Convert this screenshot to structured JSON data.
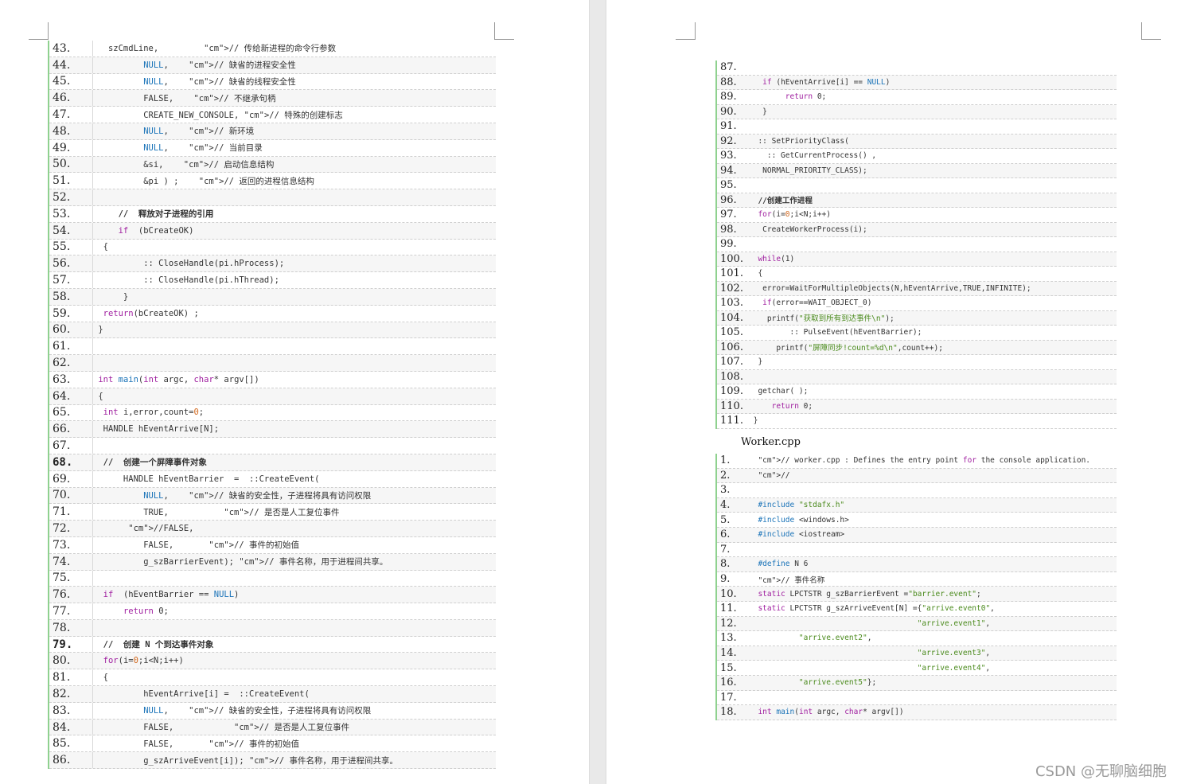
{
  "left_page": {
    "lines": [
      {
        "n": "43.",
        "code": "   szCmdLine,         // 传给新进程的命令行参数",
        "cls": "cmline"
      },
      {
        "n": "44.",
        "code": "          NULL,    // 缺省的进程安全性"
      },
      {
        "n": "45.",
        "code": "          NULL,    // 缺省的线程安全性"
      },
      {
        "n": "46.",
        "code": "          FALSE,    // 不继承句柄"
      },
      {
        "n": "47.",
        "code": "          CREATE_NEW_CONSOLE, // 特殊的创建标志"
      },
      {
        "n": "48.",
        "code": "          NULL,    // 新环境"
      },
      {
        "n": "49.",
        "code": "          NULL,    // 当前目录"
      },
      {
        "n": "50.",
        "code": "          &si,    // 启动信息结构"
      },
      {
        "n": "51.",
        "code": "          &pi ) ;    // 返回的进程信息结构"
      },
      {
        "n": "52.",
        "code": ""
      },
      {
        "n": "53.",
        "code": "     //  释放对子进程的引用"
      },
      {
        "n": "54.",
        "code": "     if  (bCreateOK)"
      },
      {
        "n": "55.",
        "code": "  {"
      },
      {
        "n": "56.",
        "code": "          :: CloseHandle(pi.hProcess);"
      },
      {
        "n": "57.",
        "code": "          :: CloseHandle(pi.hThread);"
      },
      {
        "n": "58.",
        "code": "      }"
      },
      {
        "n": "59.",
        "code": "  return(bCreateOK) ;"
      },
      {
        "n": "60.",
        "code": " }"
      },
      {
        "n": "61.",
        "code": ""
      },
      {
        "n": "62.",
        "code": ""
      },
      {
        "n": "63.",
        "code": " int main(int argc, char* argv[])"
      },
      {
        "n": "64.",
        "code": " {"
      },
      {
        "n": "65.",
        "code": "  int i,error,count=0;"
      },
      {
        "n": "66.",
        "code": "  HANDLE hEventArrive[N];"
      },
      {
        "n": "67.",
        "code": ""
      },
      {
        "n": "68.",
        "code": "  //  创建一个屏障事件对象"
      },
      {
        "n": "69.",
        "code": "      HANDLE hEventBarrier  =  ::CreateEvent("
      },
      {
        "n": "70.",
        "code": "          NULL,    // 缺省的安全性，子进程将具有访问权限"
      },
      {
        "n": "71.",
        "code": "          TRUE,           // 是否是人工复位事件"
      },
      {
        "n": "72.",
        "code": "       //FALSE,"
      },
      {
        "n": "73.",
        "code": "          FALSE,       // 事件的初始值"
      },
      {
        "n": "74.",
        "code": "          g_szBarrierEvent); // 事件名称，用于进程间共享。"
      },
      {
        "n": "75.",
        "code": ""
      },
      {
        "n": "76.",
        "code": "  if  (hEventBarrier == NULL)"
      },
      {
        "n": "77.",
        "code": "      return 0;"
      },
      {
        "n": "78.",
        "code": ""
      },
      {
        "n": "79.",
        "code": "  //  创建 N 个到达事件对象"
      },
      {
        "n": "80.",
        "code": "  for(i=0;i<N;i++)"
      },
      {
        "n": "81.",
        "code": "  {"
      },
      {
        "n": "82.",
        "code": "          hEventArrive[i] =  ::CreateEvent("
      },
      {
        "n": "83.",
        "code": "          NULL,    // 缺省的安全性，子进程将具有访问权限"
      },
      {
        "n": "84.",
        "code": "          FALSE,            // 是否是人工复位事件"
      },
      {
        "n": "85.",
        "code": "          FALSE,       // 事件的初始值"
      },
      {
        "n": "86.",
        "code": "          g_szArriveEvent[i]); // 事件名称，用于进程间共享。"
      }
    ]
  },
  "right_page": {
    "lines": [
      {
        "n": "87.",
        "code": ""
      },
      {
        "n": "88.",
        "code": "   if (hEventArrive[i] == NULL)"
      },
      {
        "n": "89.",
        "code": "        return 0;"
      },
      {
        "n": "90.",
        "code": "   }"
      },
      {
        "n": "91.",
        "code": ""
      },
      {
        "n": "92.",
        "code": "  :: SetPriorityClass("
      },
      {
        "n": "93.",
        "code": "    :: GetCurrentProcess() ,"
      },
      {
        "n": "94.",
        "code": "   NORMAL_PRIORITY_CLASS);"
      },
      {
        "n": "95.",
        "code": ""
      },
      {
        "n": "96.",
        "code": "  //创建工作进程"
      },
      {
        "n": "97.",
        "code": "  for(i=0;i<N;i++)"
      },
      {
        "n": "98.",
        "code": "   CreateWorkerProcess(i);"
      },
      {
        "n": "99.",
        "code": ""
      },
      {
        "n": "100.",
        "code": "  while(1)"
      },
      {
        "n": "101.",
        "code": "  {"
      },
      {
        "n": "102.",
        "code": "   error=WaitForMultipleObjects(N,hEventArrive,TRUE,INFINITE);"
      },
      {
        "n": "103.",
        "code": "   if(error==WAIT_OBJECT_0)"
      },
      {
        "n": "104.",
        "code": "    printf(\"获取到所有到达事件\\n\");"
      },
      {
        "n": "105.",
        "code": "         :: PulseEvent(hEventBarrier);"
      },
      {
        "n": "106.",
        "code": "      printf(\"屏障同步!count=%d\\n\",count++);"
      },
      {
        "n": "107.",
        "code": "  }"
      },
      {
        "n": "108.",
        "code": ""
      },
      {
        "n": "109.",
        "code": "  getchar( );"
      },
      {
        "n": "110.",
        "code": "     return 0;"
      },
      {
        "n": "111.",
        "code": " }"
      }
    ],
    "filename": "Worker.cpp",
    "worker_lines": [
      {
        "n": "1.",
        "code": "  // worker.cpp : Defines the entry point for the console application."
      },
      {
        "n": "2.",
        "code": "  //"
      },
      {
        "n": "3.",
        "code": ""
      },
      {
        "n": "4.",
        "code": "  #include \"stdafx.h\""
      },
      {
        "n": "5.",
        "code": "  #include <windows.h>"
      },
      {
        "n": "6.",
        "code": "  #include <iostream>"
      },
      {
        "n": "7.",
        "code": ""
      },
      {
        "n": "8.",
        "code": "  #define N 6"
      },
      {
        "n": "9.",
        "code": "  // 事件名称"
      },
      {
        "n": "10.",
        "code": "  static LPCTSTR g_szBarrierEvent =\"barrier.event\";"
      },
      {
        "n": "11.",
        "code": "  static LPCTSTR g_szArriveEvent[N] ={\"arrive.event0\","
      },
      {
        "n": "12.",
        "code": "                                     \"arrive.event1\","
      },
      {
        "n": "13.",
        "code": "           \"arrive.event2\","
      },
      {
        "n": "14.",
        "code": "                                     \"arrive.event3\","
      },
      {
        "n": "15.",
        "code": "                                     \"arrive.event4\","
      },
      {
        "n": "16.",
        "code": "           \"arrive.event5\"};"
      },
      {
        "n": "17.",
        "code": ""
      },
      {
        "n": "18.",
        "code": "  int main(int argc, char* argv[])"
      }
    ]
  },
  "watermark": "CSDN @无聊脑细胞"
}
